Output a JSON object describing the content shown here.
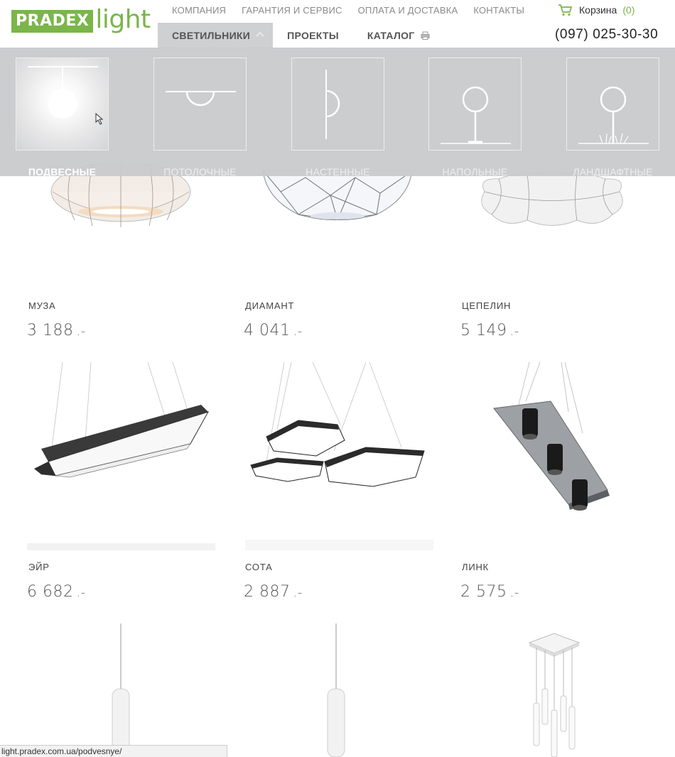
{
  "logo": {
    "brand": "PRADEX",
    "suffix": "light"
  },
  "topnav": [
    "КОМПАНИЯ",
    "ГАРАНТИЯ И СЕРВИС",
    "ОПЛАТА И ДОСТАВКА",
    "КОНТАКТЫ"
  ],
  "cart": {
    "label": "Корзина",
    "count": "(0)"
  },
  "mainnav": {
    "lamps": "СВЕТИЛЬНИКИ",
    "projects": "ПРОЕКТЫ",
    "catalog": "КАТАЛОГ"
  },
  "phone": "(097) 025-30-30",
  "categories": [
    {
      "label": "ПОДВЕСНЫЕ"
    },
    {
      "label": "ПОТОЛОЧНЫЕ"
    },
    {
      "label": "НАСТЕННЫЕ"
    },
    {
      "label": "НАПОЛЬНЫЕ"
    },
    {
      "label": "ЛАНДШАФТНЫЕ"
    }
  ],
  "products": [
    {
      "name": "МУЗА",
      "price": "3 188",
      "currency": ".-"
    },
    {
      "name": "ДИАМАНТ",
      "price": "4 041",
      "currency": ".-"
    },
    {
      "name": "ЦЕПЕЛИН",
      "price": "5 149",
      "currency": ".-"
    },
    {
      "name": "ЭЙР",
      "price": "6 682",
      "currency": ".-"
    },
    {
      "name": "СОТА",
      "price": "2 887",
      "currency": ".-"
    },
    {
      "name": "ЛИНК",
      "price": "2 575",
      "currency": ".-"
    }
  ],
  "status_url": "light.pradex.com.ua/podvesnye/",
  "colors": {
    "accent": "#7ab648",
    "dropdown": "#c8c9cb"
  }
}
